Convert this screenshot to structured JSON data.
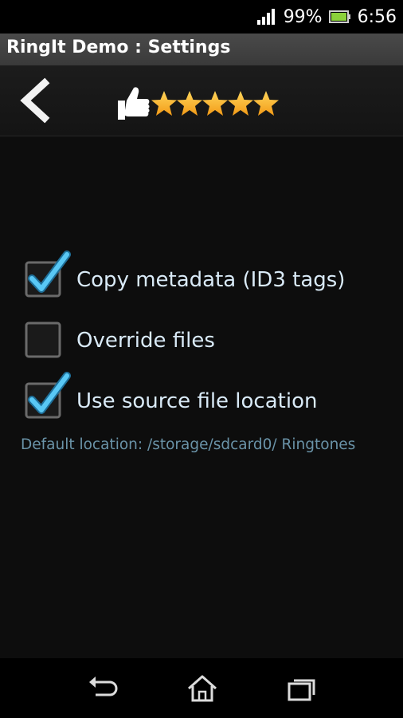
{
  "status_bar": {
    "battery": "99%",
    "time": "6:56",
    "icons": [
      "signal-icon",
      "battery-icon"
    ]
  },
  "title_bar": {
    "title": "RingIt Demo : Settings"
  },
  "action_bar": {
    "icons": [
      "back-chevron-icon",
      "thumbs-up-icon",
      "star-icon"
    ],
    "rating_stars": 5,
    "star_color": "#f5a623"
  },
  "preferences": [
    {
      "label": "Copy metadata (ID3 tags)",
      "checked": true
    },
    {
      "label": "Override files",
      "checked": false
    },
    {
      "label": "Use source file location",
      "checked": true
    }
  ],
  "location_summary": "Default location: /storage/sdcard0/ Ringtones",
  "nav_bar": {
    "icons": [
      "back-icon",
      "home-icon",
      "recent-apps-icon"
    ]
  },
  "colors": {
    "label_text": "#d9eaf7",
    "summary_text": "#6a93a8",
    "checkmark": "#59c8f5"
  }
}
